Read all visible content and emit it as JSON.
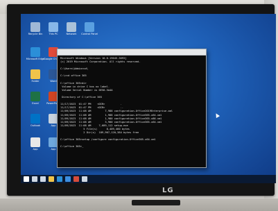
{
  "monitor": {
    "brand": "LG"
  },
  "desktop": {
    "icons": [
      {
        "name": "recycle-bin-icon",
        "label": "Recycle Bin",
        "color": "#9fb8d6"
      },
      {
        "name": "this-pc-icon",
        "label": "This PC",
        "color": "#87b7e8"
      },
      {
        "name": "network-icon",
        "label": "Network",
        "color": "#a9c1d9"
      },
      {
        "name": "control-panel-icon",
        "label": "Control Panel",
        "color": "#5aa0e0"
      },
      {
        "name": "edge-icon",
        "label": "Microsoft Edge",
        "color": "#2b8fd8"
      },
      {
        "name": "chrome-icon",
        "label": "Google Chrome",
        "color": "#e04b3a"
      },
      {
        "name": "folder-icon",
        "label": "Folder",
        "color": "#f0c44a"
      },
      {
        "name": "word-icon",
        "label": "Word",
        "color": "#2b5797"
      },
      {
        "name": "excel-icon",
        "label": "Excel",
        "color": "#1e7145"
      },
      {
        "name": "powerpoint-icon",
        "label": "PowerPoint",
        "color": "#d04423"
      },
      {
        "name": "outlook-icon",
        "label": "Outlook",
        "color": "#0072c6"
      },
      {
        "name": "app-icon",
        "label": "App",
        "color": "#c9d3dd"
      },
      {
        "name": "app-icon",
        "label": "App",
        "color": "#e8e8e8"
      },
      {
        "name": "app-icon",
        "label": "App",
        "color": "#6fa8dc"
      }
    ]
  },
  "cmd": {
    "lines": [
      "Microsoft Windows [Version 10.0.19045.3693]",
      "(c) 2019 Microsoft Corporation. All rights reserved.",
      "",
      "C:\\Users\\Admin>cd\\",
      "",
      "C:\\>cd office 365",
      "",
      "C:\\office 365>dir",
      " Volume in drive C has no label.",
      " Volume Serial Number is 0E50-5A4A",
      "",
      " Directory of C:\\office 365",
      "",
      "11/17/2023  01:47 PM    <DIR>          .",
      "11/17/2023  01:47 PM    <DIR>          ..",
      "11/09/2023  11:08 AM         7,988 configuration-Office2019Enterprise.xml",
      "11/09/2023  11:08 AM         1,988 configuration-Office365-x64.xml",
      "11/09/2023  11:08 AM         1,980 configuration-Office365-x86.xml",
      "11/09/2023  11:08 AM         3,900 configuration-Office365-x64.xml",
      "11/09/2023  11:08 AM     7,689,112 setup.exe",
      "               5 File(s)      8,409,460 bytes",
      "               2 Dir(s)  189,907,120,384 bytes free",
      "",
      "C:\\office 365>setup /configure configuration-Office365-x64.xml",
      "",
      "C:\\office 365>_"
    ]
  },
  "taskbar": {
    "buttons": [
      {
        "name": "start-button",
        "color": "#ffffff"
      },
      {
        "name": "search-button",
        "color": "#cfd8e3"
      },
      {
        "name": "task-view-button",
        "color": "#cfd8e3"
      },
      {
        "name": "file-explorer-button",
        "color": "#f0c44a"
      },
      {
        "name": "edge-button",
        "color": "#2b8fd8"
      },
      {
        "name": "store-button",
        "color": "#3c8ee0"
      },
      {
        "name": "cmd-button",
        "color": "#d64b3a"
      },
      {
        "name": "app-button",
        "color": "#cfd8e3"
      }
    ],
    "tray": {
      "time": "",
      "date": ""
    }
  }
}
